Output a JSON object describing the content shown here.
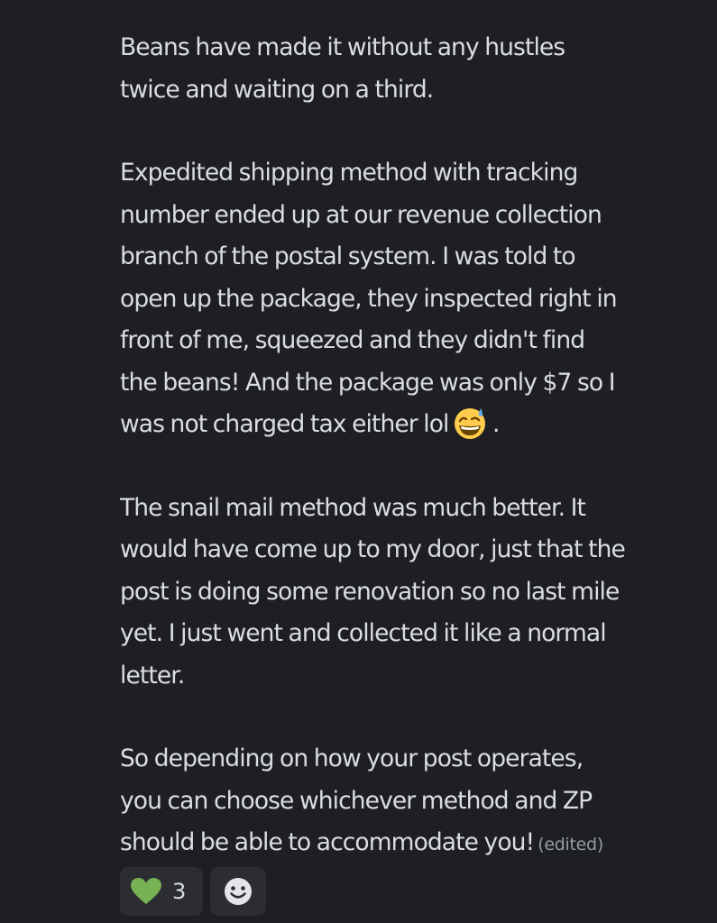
{
  "message": {
    "paragraphs": [
      {
        "lines": [
          "Beans have made it without any hustles",
          "twice and waiting on a third."
        ]
      },
      {
        "lines": [
          "Expedited shipping method with tracking",
          "number ended up at our revenue collection",
          "branch of the postal system. I was told to",
          "open up the package, they inspected right in",
          "front of me, squeezed and they didn't find",
          "the beans! And the package was only $7 so I",
          "was not charged tax either lol"
        ],
        "trailing_emoji": "grinning-sweat-emoji",
        "trailing_text": " ."
      },
      {
        "lines": [
          "The snail mail method was much better. It",
          "would have come up to my door, just that the",
          "post is doing some renovation so no last mile",
          "yet. I just went and collected it like a normal",
          "letter."
        ]
      },
      {
        "lines": [
          "So depending on how your post operates,",
          "you can choose whichever method and ZP",
          "should be able to accommodate you!"
        ],
        "edited_label": "(edited)"
      }
    ]
  },
  "reactions": [
    {
      "icon": "green-heart-icon",
      "count": "3",
      "color": "#77b255"
    },
    {
      "icon": "add-reaction-icon"
    }
  ],
  "colors": {
    "background": "#1e1f22",
    "text": "#dbdee1",
    "muted": "#949ba4",
    "reaction_bg": "#2b2d31"
  }
}
